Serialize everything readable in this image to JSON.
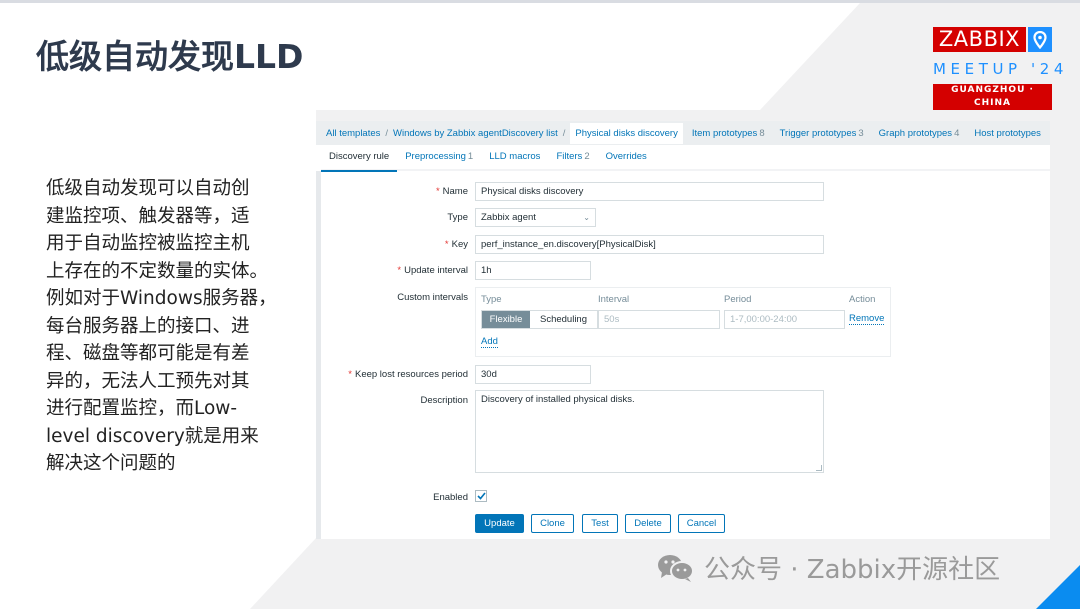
{
  "slide": {
    "title": "低级自动发现LLD",
    "body": "低级自动发现可以自动创建监控项、触发器等，适用于自动监控被监控主机上存在的不定数量的实体。例如对于Windows服务器，每台服务器上的接口、进程、磁盘等都可能是有差异的，无法人工预先对其进行配置监控，而Low-level discovery就是用来解决这个问题的",
    "body_lines": [
      "低级自动发现可以自动创",
      "建监控项、触发器等，适",
      "用于自动监控被监控主机",
      "上存在的不定数量的实体。",
      "例如对于Windows服务器，",
      "每台服务器上的接口、进",
      "程、磁盘等都可能是有差",
      "异的，无法人工预先对其",
      "进行配置监控，而Low-",
      "level discovery就是用来",
      "解决这个问题的"
    ]
  },
  "logo": {
    "brand": "ZABBIX",
    "event": "MEETUP '24",
    "location": "GUANGZHOU · CHINA",
    "icon": "location-pin-icon",
    "colors": {
      "red": "#d40000",
      "blue": "#1e90ff"
    }
  },
  "zabbix": {
    "breadcrumbs": {
      "all_templates": "All templates",
      "template": "Windows by Zabbix agent",
      "discovery_list": "Discovery list",
      "current": "Physical disks discovery",
      "separator": "/"
    },
    "related_tabs": [
      {
        "label": "Item prototypes",
        "count": "8"
      },
      {
        "label": "Trigger prototypes",
        "count": "3"
      },
      {
        "label": "Graph prototypes",
        "count": "4"
      },
      {
        "label": "Host prototypes",
        "count": ""
      }
    ],
    "tabs": [
      {
        "label": "Discovery rule",
        "count": "",
        "active": true
      },
      {
        "label": "Preprocessing",
        "count": "1"
      },
      {
        "label": "LLD macros",
        "count": ""
      },
      {
        "label": "Filters",
        "count": "2"
      },
      {
        "label": "Overrides",
        "count": ""
      }
    ],
    "form": {
      "required_mark": "*",
      "name": {
        "label": "Name",
        "value": "Physical disks discovery"
      },
      "type": {
        "label": "Type",
        "value": "Zabbix agent"
      },
      "key": {
        "label": "Key",
        "value": "perf_instance_en.discovery[PhysicalDisk]"
      },
      "update_interval": {
        "label": "Update interval",
        "value": "1h"
      },
      "custom_intervals": {
        "label": "Custom intervals",
        "headers": {
          "type": "Type",
          "interval": "Interval",
          "period": "Period",
          "action": "Action"
        },
        "rows": [
          {
            "type_selected": "Flexible",
            "type_options": [
              "Flexible",
              "Scheduling"
            ],
            "interval_placeholder": "50s",
            "period_placeholder": "1-7,00:00-24:00",
            "action": "Remove"
          }
        ],
        "add_label": "Add"
      },
      "keep_lost": {
        "label": "Keep lost resources period",
        "value": "30d"
      },
      "description": {
        "label": "Description",
        "value": "Discovery of installed physical disks."
      },
      "enabled": {
        "label": "Enabled",
        "checked": true
      }
    },
    "buttons": {
      "update": "Update",
      "clone": "Clone",
      "test": "Test",
      "delete": "Delete",
      "cancel": "Cancel"
    },
    "colors": {
      "link": "#0275b8",
      "required": "#e33734",
      "muted": "#768d99"
    }
  },
  "watermark": {
    "icon": "wechat-icon",
    "text": "公众号 · Zabbix开源社区"
  }
}
